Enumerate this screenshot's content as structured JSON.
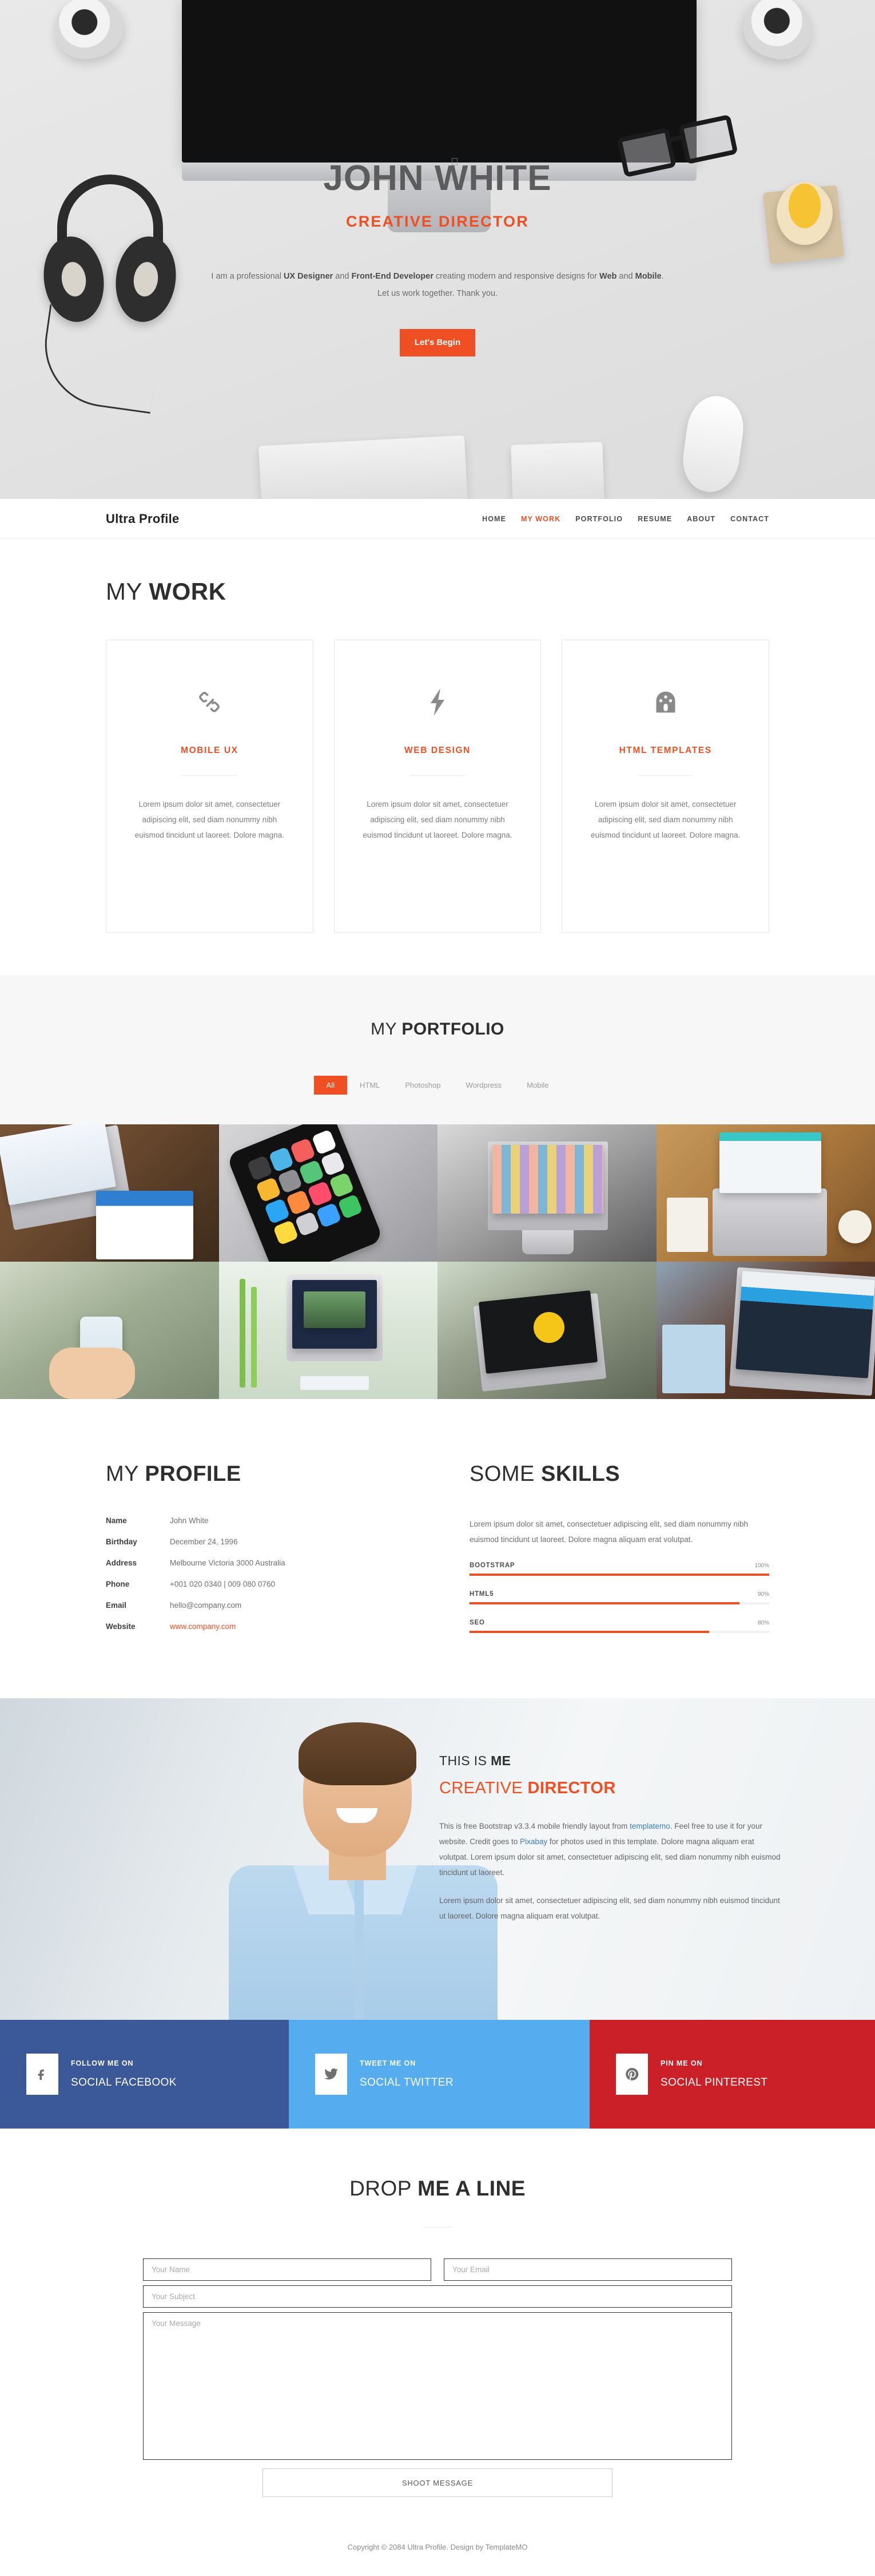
{
  "hero": {
    "name": "JOHN WHITE",
    "role": "CREATIVE DIRECTOR",
    "desc_part1": "I am a professional ",
    "desc_b1": "UX Designer",
    "desc_part2": " and ",
    "desc_b2": "Front-End Developer",
    "desc_part3": " creating modern and responsive designs for ",
    "desc_b3": "Web",
    "desc_part4": " and ",
    "desc_b4": "Mobile",
    "desc_part5": ". Let us work together. Thank you.",
    "cta_label": "Let's Begin"
  },
  "nav": {
    "brand": "Ultra Profile",
    "items": [
      {
        "label": "HOME",
        "active": false
      },
      {
        "label": "MY WORK",
        "active": true
      },
      {
        "label": "PORTFOLIO",
        "active": false
      },
      {
        "label": "RESUME",
        "active": false
      },
      {
        "label": "ABOUT",
        "active": false
      },
      {
        "label": "CONTACT",
        "active": false
      }
    ]
  },
  "work": {
    "title_light": "MY ",
    "title_bold": "WORK",
    "cards": [
      {
        "icon": "link-icon",
        "title": "MOBILE UX",
        "text": "Lorem ipsum dolor sit amet, consectetuer adipiscing elit, sed diam nonummy nibh euismod tincidunt ut laoreet. Dolore magna."
      },
      {
        "icon": "bolt-icon",
        "title": "WEB DESIGN",
        "text": "Lorem ipsum dolor sit amet, consectetuer adipiscing elit, sed diam nonummy nibh euismod tincidunt ut laoreet. Dolore magna."
      },
      {
        "icon": "palette-icon",
        "title": "HTML TEMPLATES",
        "text": "Lorem ipsum dolor sit amet, consectetuer adipiscing elit, sed diam nonummy nibh euismod tincidunt ut laoreet. Dolore magna."
      }
    ]
  },
  "portfolio": {
    "title_light": "MY ",
    "title_bold": "PORTFOLIO",
    "filters": [
      {
        "label": "All",
        "active": true
      },
      {
        "label": "HTML",
        "active": false
      },
      {
        "label": "Photoshop",
        "active": false
      },
      {
        "label": "Wordpress",
        "active": false
      },
      {
        "label": "Mobile",
        "active": false
      }
    ],
    "tiles": [
      "laptop-tablet-pricing-page",
      "iphone-app-icons-on-macbook",
      "imac-photo-gallery-greyscale",
      "laptop-tablet-wooden-desk",
      "hands-holding-phone-outdoors",
      "imac-with-plant-white-desk",
      "laptop-firmbee-drag-your-screen-here",
      "person-typing-laptop-website"
    ]
  },
  "profile": {
    "title_light": "MY ",
    "title_bold": "PROFILE",
    "rows": [
      {
        "label": "Name",
        "value": "John White",
        "link": false
      },
      {
        "label": "Birthday",
        "value": "December 24, 1996",
        "link": false
      },
      {
        "label": "Address",
        "value": "Melbourne Victoria 3000 Australia",
        "link": false
      },
      {
        "label": "Phone",
        "value": "+001 020 0340 | 009 080 0760",
        "link": false
      },
      {
        "label": "Email",
        "value": "hello@company.com",
        "link": false
      },
      {
        "label": "Website",
        "value": "www.company.com",
        "link": true
      }
    ]
  },
  "skills": {
    "title_light": "SOME ",
    "title_bold": "SKILLS",
    "desc": "Lorem ipsum dolor sit amet, consectetuer adipiscing elit, sed diam nonummy nibh euismod tincidunt ut laoreet. Dolore magna aliquam erat volutpat.",
    "bars": [
      {
        "name": "BOOTSTRAP",
        "pct_label": "100%",
        "pct": 100
      },
      {
        "name": "HTML5",
        "pct_label": "90%",
        "pct": 90
      },
      {
        "name": "SEO",
        "pct_label": "80%",
        "pct": 80
      }
    ]
  },
  "about": {
    "kicker_light": "THIS IS ",
    "kicker_bold": "ME",
    "title_light": "CREATIVE ",
    "title_bold": "DIRECTOR",
    "p1_a": "This is free Bootstrap v3.3.4 mobile friendly layout from ",
    "p1_link1": "templatemo",
    "p1_b": ". Feel free to use it for your website. Credit goes to ",
    "p1_link2": "Pixabay",
    "p1_c": " for photos used in this template. Dolore magna aliquam erat volutpat. Lorem ipsum dolor sit amet, consectetuer adipiscing elit, sed diam nonummy nibh euismod tincidunt ut laoreet.",
    "p2": "Lorem ipsum dolor sit amet, consectetuer adipiscing elit, sed diam nonummy nibh euismod tincidunt ut laoreet. Dolore magna aliquam erat volutpat."
  },
  "social": [
    {
      "icon": "facebook-icon",
      "sub": "FOLLOW ME ON",
      "name": "SOCIAL FACEBOOK",
      "color": "#3b5998"
    },
    {
      "icon": "twitter-icon",
      "sub": "TWEET ME ON",
      "name": "SOCIAL TWITTER",
      "color": "#55acee"
    },
    {
      "icon": "pinterest-icon",
      "sub": "PIN ME ON",
      "name": "SOCIAL PINTEREST",
      "color": "#cb2027"
    }
  ],
  "contact": {
    "title_light": "DROP ",
    "title_bold": "ME A LINE",
    "name_placeholder": "Your Name",
    "email_placeholder": "Your Email",
    "subject_placeholder": "Your Subject",
    "message_placeholder": "Your Message",
    "submit_label": "SHOOT MESSAGE"
  },
  "footer": {
    "copyright": "Copyright © 2084 Ultra Profile. Design by TemplateMO"
  },
  "colors": {
    "accent": "#f04e23",
    "facebook": "#3b5998",
    "twitter": "#55acee",
    "pinterest": "#cb2027",
    "heading": "#2e2e2e"
  }
}
